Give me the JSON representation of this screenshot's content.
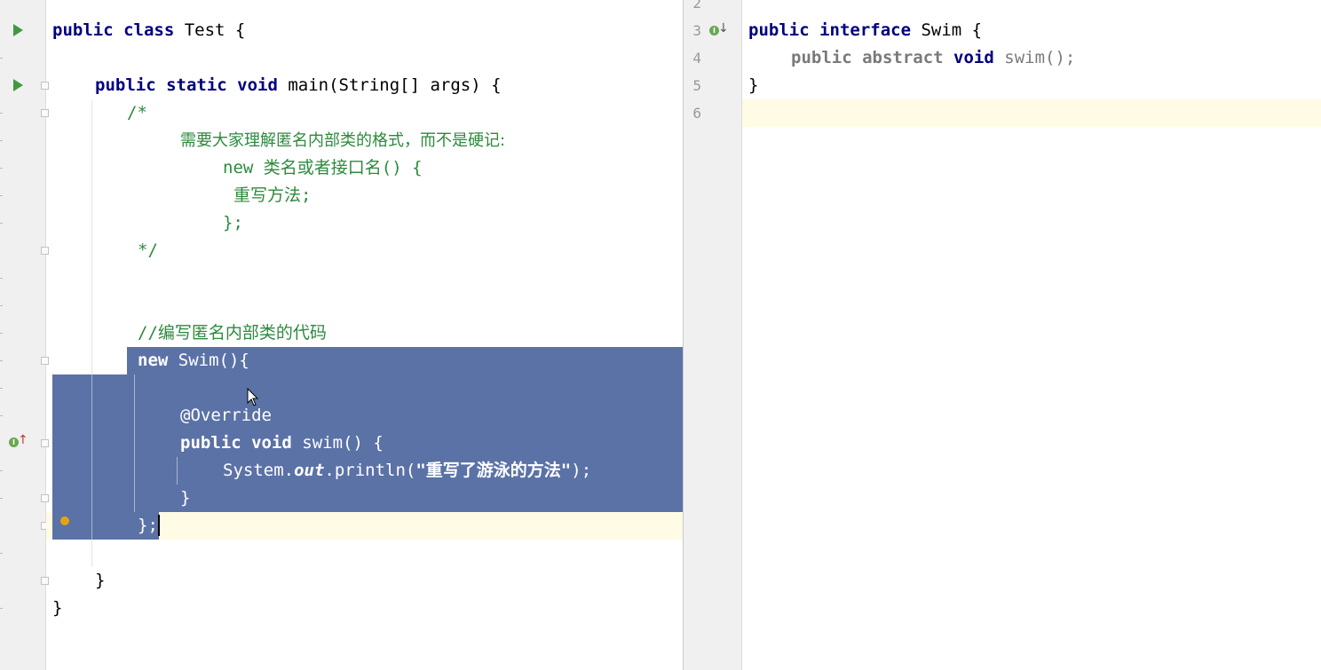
{
  "left_editor": {
    "lines": {
      "class_decl": {
        "kw": "public class",
        "rest": " Test {"
      },
      "main_decl": {
        "kw": "public static void",
        "rest": " main(String[] args) {"
      },
      "c1": "/*",
      "c2": "需要大家理解匿名内部类的格式，而不是硬记:",
      "c3": "new 类名或者接口名() {",
      "c4": "重写方法;",
      "c5": "};",
      "c6": "*/",
      "c7": "//编写匿名内部类的代码",
      "new_kw": "new",
      "new_rest": " Swim(){",
      "override": "@Override",
      "swim_kw": "public void",
      "swim_rest": " swim() {",
      "println_pre": "System.",
      "println_field": "out",
      "println_mid": ".println(",
      "println_str": "\"重写了游泳的方法\"",
      "println_end": ");",
      "close_method": "}",
      "close_anon": "};",
      "close_main": "}",
      "close_class": "}"
    }
  },
  "right_editor": {
    "line_numbers": [
      "2",
      "3",
      "4",
      "5",
      "6"
    ],
    "interface_decl": {
      "kw": "public interface",
      "rest": " Swim {"
    },
    "method_decl": {
      "mod": "public abstract",
      "kw": "void",
      "rest": " swim();"
    },
    "close": "}"
  },
  "colors": {
    "selection": "#5b72a6",
    "caret_line": "#fffbe5",
    "keyword": "#000080",
    "comment": "#2d8a3d",
    "run_icon": "#3f9a3f",
    "bulb": "#e5a314"
  }
}
